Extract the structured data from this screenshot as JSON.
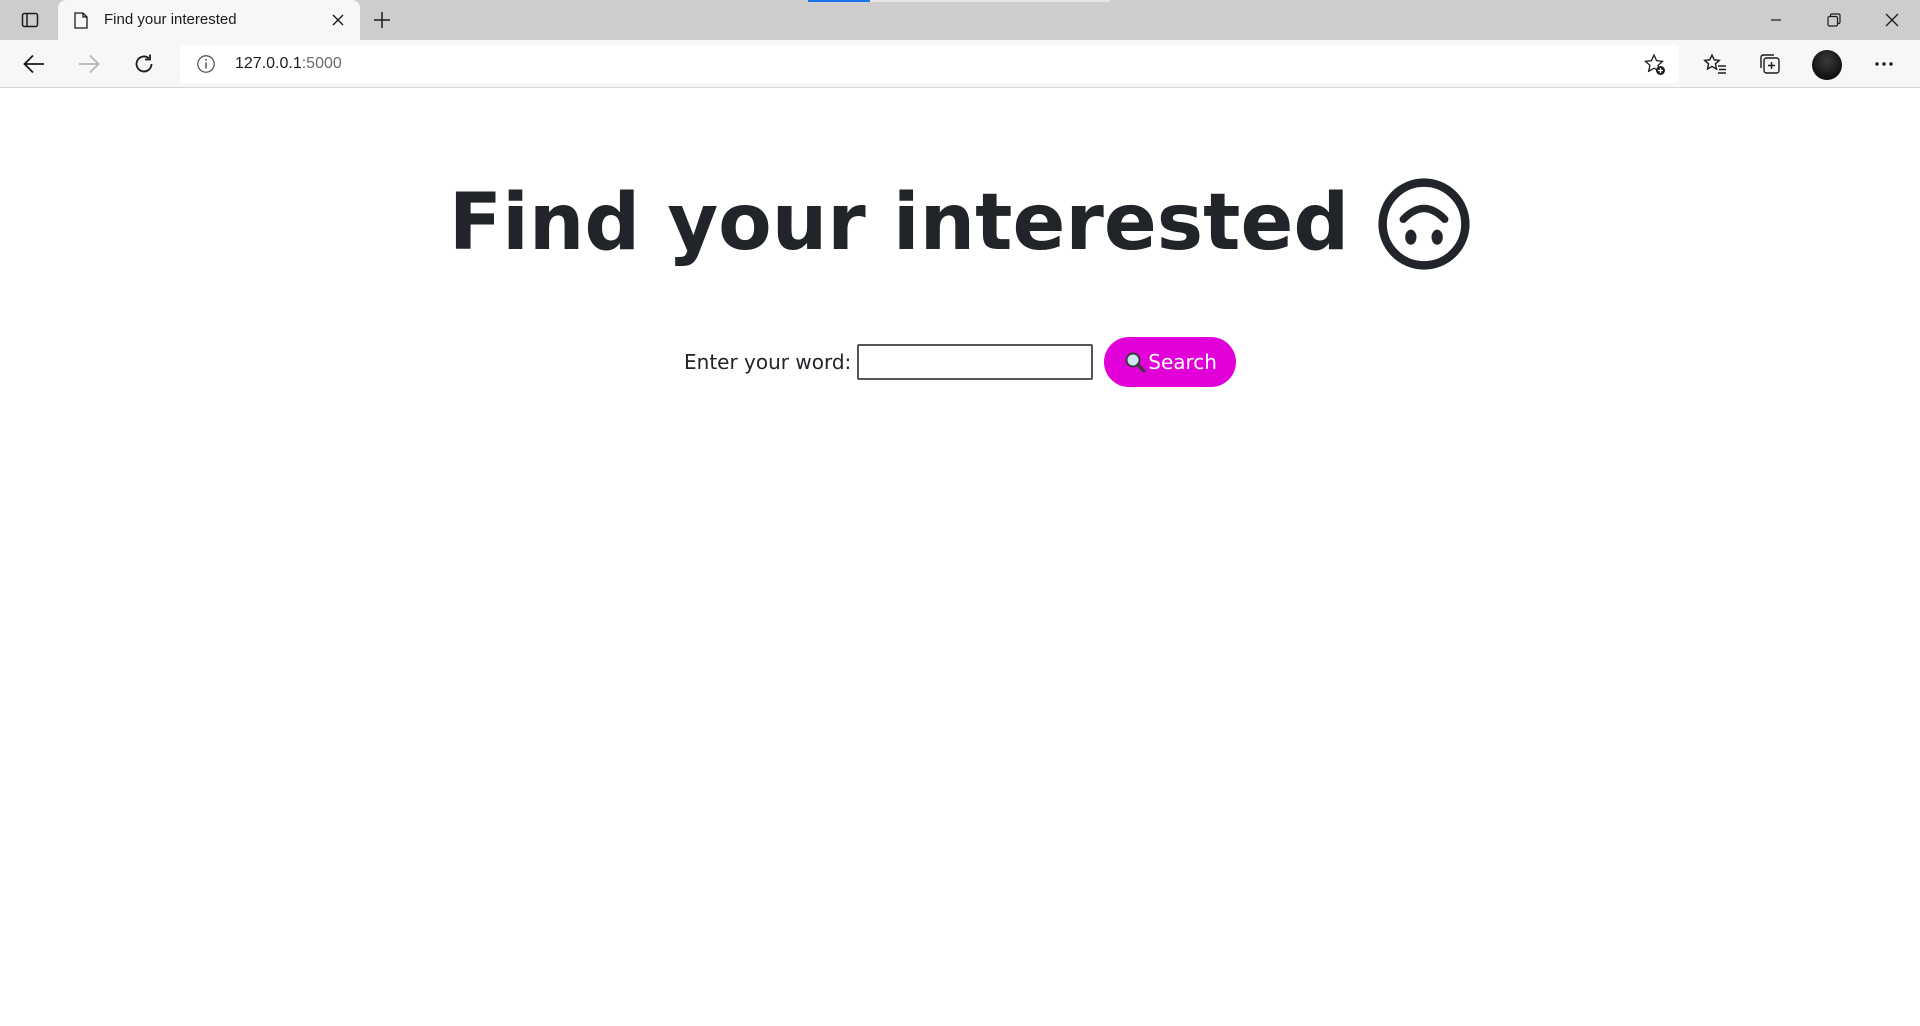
{
  "browser": {
    "tab_title": "Find your interested",
    "url_host": "127.0.0.1",
    "url_port": ":5000",
    "icons": {
      "tab_actions": "tab-actions-icon",
      "favicon": "page-icon",
      "close_tab": "close-icon",
      "new_tab": "plus-icon",
      "minimize": "minimize-icon",
      "restore": "restore-icon",
      "close_window": "close-icon",
      "back": "back-arrow-icon",
      "forward": "forward-arrow-icon",
      "refresh": "refresh-icon",
      "site_info": "info-icon",
      "add_favorite": "star-add-icon",
      "favorites": "favorites-icon",
      "collections": "collections-icon",
      "profile": "avatar",
      "more": "more-icon"
    }
  },
  "page": {
    "heading": "Find your interested",
    "heading_emoji": "upside-down-face-icon",
    "search": {
      "label": "Enter your word:",
      "input_value": "",
      "input_placeholder": "",
      "button_label": "Search",
      "button_icon": "magnifier-icon"
    }
  },
  "colors": {
    "search_button_bg": "#e100d8",
    "search_button_text": "#ffffff",
    "heading_text": "#212529",
    "tab_indicator": "#1a73e8"
  }
}
